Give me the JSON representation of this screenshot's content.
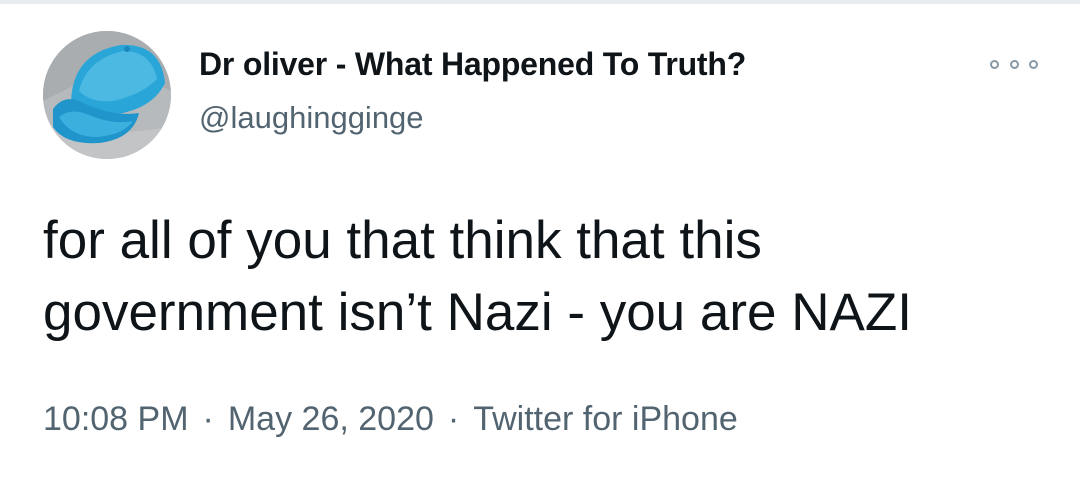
{
  "author": {
    "display_name": "Dr oliver - What Happened To Truth?",
    "handle": "@laughingginge",
    "avatar_icon": "blue-cap-avatar"
  },
  "more_icon": "more-options-icon",
  "tweet": {
    "text": "for all of you that think that this\ngovernment isn’t Nazi - you are NAZI"
  },
  "meta": {
    "time": "10:08 PM",
    "separator": "·",
    "date": "May 26, 2020",
    "source": "Twitter for iPhone"
  },
  "colors": {
    "text_primary": "#0f1419",
    "text_secondary": "#536471",
    "avatar_cap": "#2fa7d6"
  }
}
